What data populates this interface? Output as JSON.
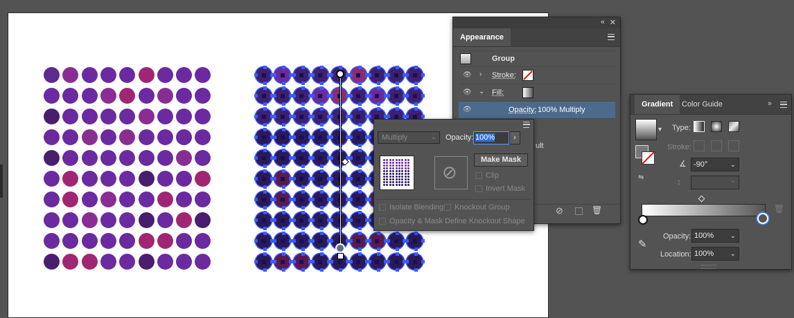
{
  "canvas": {
    "left_colors": [
      [
        "#5d2a8d",
        "#8a2d93",
        "#6b2aa0",
        "#6b2aa0",
        "#6b2aa0",
        "#a02673",
        "#6b2aa0",
        "#6b2aa0",
        "#6b2aa0"
      ],
      [
        "#6b2aa0",
        "#6b2aa0",
        "#6b2aa0",
        "#8a2d93",
        "#a02673",
        "#6b2aa0",
        "#8a2d93",
        "#6b2aa0",
        "#6b2aa0"
      ],
      [
        "#4a1e6e",
        "#6b2aa0",
        "#6b2aa0",
        "#6b2aa0",
        "#6b2aa0",
        "#8a2d93",
        "#6b2aa0",
        "#6b2aa0",
        "#6b2aa0"
      ],
      [
        "#6b2aa0",
        "#6b2aa0",
        "#8a2d93",
        "#6b2aa0",
        "#8a2d93",
        "#6b2aa0",
        "#6b2aa0",
        "#6b2aa0",
        "#6b2aa0"
      ],
      [
        "#4a1e6e",
        "#6b2aa0",
        "#6b2aa0",
        "#6b2aa0",
        "#6b2aa0",
        "#6b2aa0",
        "#6b2aa0",
        "#8a2d93",
        "#6b2aa0"
      ],
      [
        "#6b2aa0",
        "#a02673",
        "#6b2aa0",
        "#6b2aa0",
        "#6b2aa0",
        "#4a1e6e",
        "#6b2aa0",
        "#6b2aa0",
        "#a02673"
      ],
      [
        "#6b2aa0",
        "#a02673",
        "#6b2aa0",
        "#8a2d93",
        "#6b2aa0",
        "#6b2aa0",
        "#a02673",
        "#6b2aa0",
        "#6b2aa0"
      ],
      [
        "#6b2aa0",
        "#6b2aa0",
        "#8a2d93",
        "#6b2aa0",
        "#6b2aa0",
        "#4a1e6e",
        "#6b2aa0",
        "#a02673",
        "#4a1e6e"
      ],
      [
        "#6b2aa0",
        "#6b2aa0",
        "#6b2aa0",
        "#6b2aa0",
        "#6b2aa0",
        "#a02673",
        "#a02673",
        "#6b2aa0",
        "#6b2aa0"
      ],
      [
        "#4a1e6e",
        "#a02673",
        "#a02673",
        "#6b2aa0",
        "#6b2aa0",
        "#4a1e6e",
        "#6b2aa0",
        "#6b2aa0",
        "#6b2aa0"
      ]
    ],
    "right_dark": "#2a1a5a",
    "right_mid": "#3d2070",
    "right_red": "#5a1a4e"
  },
  "appearance": {
    "tab": "Appearance",
    "group_label": "Group",
    "stroke_label": "Stroke:",
    "fill_label": "Fill:",
    "opacity_label": "Opacity:",
    "opacity_value": "100% Multiply",
    "partial_text": "ult"
  },
  "transparency_popup": {
    "blend_mode": "Multiply",
    "opacity_label": "Opacity:",
    "opacity_value": "100%",
    "make_mask": "Make Mask",
    "clip": "Clip",
    "invert_mask": "Invert Mask",
    "isolate_blending": "Isolate Blending",
    "knockout_group": "Knockout Group",
    "opacity_mask_define": "Opacity & Mask Define Knockout Shape"
  },
  "gradient": {
    "tab_gradient": "Gradient",
    "tab_color_guide": "Color Guide",
    "type_label": "Type:",
    "stroke_label": "Stroke:",
    "angle_value": "-90°",
    "opacity_label": "Opacity:",
    "opacity_value": "100%",
    "location_label": "Location:",
    "location_value": "100%"
  },
  "colors": {
    "accent_blue": "#3b5bff",
    "panel_bg": "#535353",
    "highlight_row": "#4b6a8c"
  }
}
